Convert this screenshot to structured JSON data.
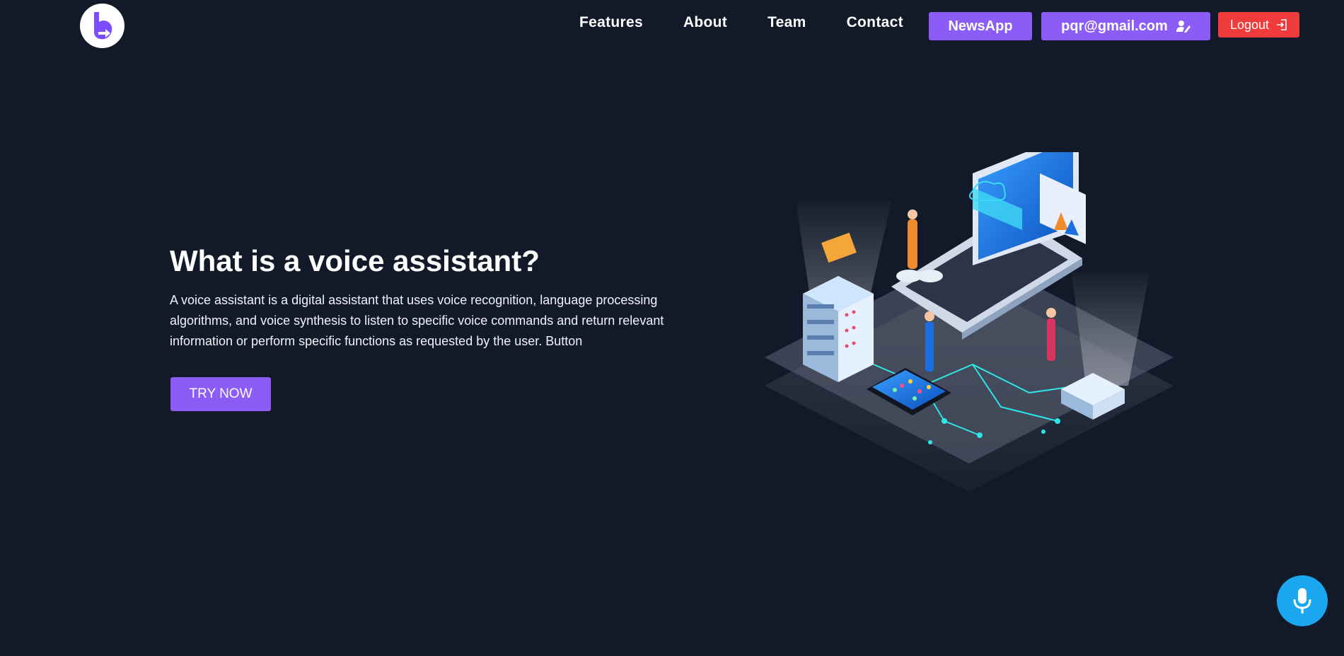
{
  "nav": {
    "items": [
      "Features",
      "About",
      "Team",
      "Contact"
    ]
  },
  "header": {
    "news_label": "NewsApp",
    "user_email": "pqr@gmail.com",
    "logout_label": "Logout"
  },
  "hero": {
    "title": "What is a voice assistant?",
    "description": "A voice assistant is a digital assistant that uses voice recognition, language processing algorithms, and voice synthesis to listen to specific voice commands and return relevant information or perform specific functions as requested by the user. Button",
    "cta_label": "TRY NOW"
  },
  "icons": {
    "logo": "logo-icon",
    "user_edit": "user-edit-icon",
    "logout": "logout-icon",
    "mic": "microphone-icon"
  },
  "colors": {
    "background": "#121a2a",
    "accent": "#8b5cf6",
    "logout": "#ef3b3b",
    "mic": "#1aa7f0"
  }
}
